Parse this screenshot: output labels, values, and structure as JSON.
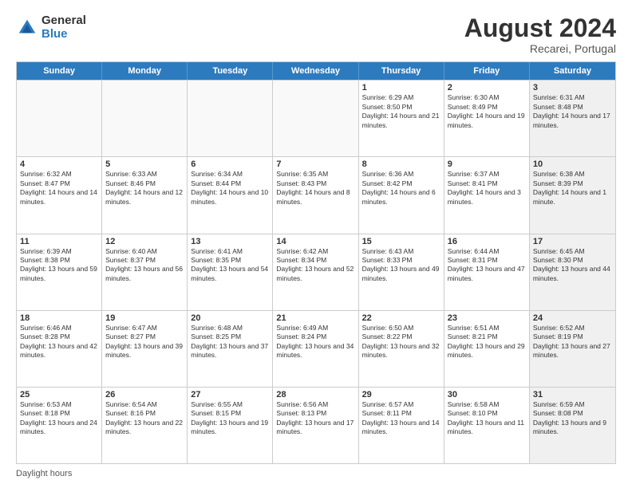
{
  "header": {
    "logo_general": "General",
    "logo_blue": "Blue",
    "month_title": "August 2024",
    "subtitle": "Recarei, Portugal"
  },
  "calendar": {
    "days": [
      "Sunday",
      "Monday",
      "Tuesday",
      "Wednesday",
      "Thursday",
      "Friday",
      "Saturday"
    ],
    "rows": [
      [
        {
          "day": "",
          "empty": true
        },
        {
          "day": "",
          "empty": true
        },
        {
          "day": "",
          "empty": true
        },
        {
          "day": "",
          "empty": true
        },
        {
          "day": "1",
          "sunrise": "6:29 AM",
          "sunset": "8:50 PM",
          "daylight": "14 hours and 21 minutes."
        },
        {
          "day": "2",
          "sunrise": "6:30 AM",
          "sunset": "8:49 PM",
          "daylight": "14 hours and 19 minutes."
        },
        {
          "day": "3",
          "sunrise": "6:31 AM",
          "sunset": "8:48 PM",
          "daylight": "14 hours and 17 minutes.",
          "shaded": true
        }
      ],
      [
        {
          "day": "4",
          "sunrise": "6:32 AM",
          "sunset": "8:47 PM",
          "daylight": "14 hours and 14 minutes."
        },
        {
          "day": "5",
          "sunrise": "6:33 AM",
          "sunset": "8:46 PM",
          "daylight": "14 hours and 12 minutes."
        },
        {
          "day": "6",
          "sunrise": "6:34 AM",
          "sunset": "8:44 PM",
          "daylight": "14 hours and 10 minutes."
        },
        {
          "day": "7",
          "sunrise": "6:35 AM",
          "sunset": "8:43 PM",
          "daylight": "14 hours and 8 minutes."
        },
        {
          "day": "8",
          "sunrise": "6:36 AM",
          "sunset": "8:42 PM",
          "daylight": "14 hours and 6 minutes."
        },
        {
          "day": "9",
          "sunrise": "6:37 AM",
          "sunset": "8:41 PM",
          "daylight": "14 hours and 3 minutes."
        },
        {
          "day": "10",
          "sunrise": "6:38 AM",
          "sunset": "8:39 PM",
          "daylight": "14 hours and 1 minute.",
          "shaded": true
        }
      ],
      [
        {
          "day": "11",
          "sunrise": "6:39 AM",
          "sunset": "8:38 PM",
          "daylight": "13 hours and 59 minutes."
        },
        {
          "day": "12",
          "sunrise": "6:40 AM",
          "sunset": "8:37 PM",
          "daylight": "13 hours and 56 minutes."
        },
        {
          "day": "13",
          "sunrise": "6:41 AM",
          "sunset": "8:35 PM",
          "daylight": "13 hours and 54 minutes."
        },
        {
          "day": "14",
          "sunrise": "6:42 AM",
          "sunset": "8:34 PM",
          "daylight": "13 hours and 52 minutes."
        },
        {
          "day": "15",
          "sunrise": "6:43 AM",
          "sunset": "8:33 PM",
          "daylight": "13 hours and 49 minutes."
        },
        {
          "day": "16",
          "sunrise": "6:44 AM",
          "sunset": "8:31 PM",
          "daylight": "13 hours and 47 minutes."
        },
        {
          "day": "17",
          "sunrise": "6:45 AM",
          "sunset": "8:30 PM",
          "daylight": "13 hours and 44 minutes.",
          "shaded": true
        }
      ],
      [
        {
          "day": "18",
          "sunrise": "6:46 AM",
          "sunset": "8:28 PM",
          "daylight": "13 hours and 42 minutes."
        },
        {
          "day": "19",
          "sunrise": "6:47 AM",
          "sunset": "8:27 PM",
          "daylight": "13 hours and 39 minutes."
        },
        {
          "day": "20",
          "sunrise": "6:48 AM",
          "sunset": "8:25 PM",
          "daylight": "13 hours and 37 minutes."
        },
        {
          "day": "21",
          "sunrise": "6:49 AM",
          "sunset": "8:24 PM",
          "daylight": "13 hours and 34 minutes."
        },
        {
          "day": "22",
          "sunrise": "6:50 AM",
          "sunset": "8:22 PM",
          "daylight": "13 hours and 32 minutes."
        },
        {
          "day": "23",
          "sunrise": "6:51 AM",
          "sunset": "8:21 PM",
          "daylight": "13 hours and 29 minutes."
        },
        {
          "day": "24",
          "sunrise": "6:52 AM",
          "sunset": "8:19 PM",
          "daylight": "13 hours and 27 minutes.",
          "shaded": true
        }
      ],
      [
        {
          "day": "25",
          "sunrise": "6:53 AM",
          "sunset": "8:18 PM",
          "daylight": "13 hours and 24 minutes."
        },
        {
          "day": "26",
          "sunrise": "6:54 AM",
          "sunset": "8:16 PM",
          "daylight": "13 hours and 22 minutes."
        },
        {
          "day": "27",
          "sunrise": "6:55 AM",
          "sunset": "8:15 PM",
          "daylight": "13 hours and 19 minutes."
        },
        {
          "day": "28",
          "sunrise": "6:56 AM",
          "sunset": "8:13 PM",
          "daylight": "13 hours and 17 minutes."
        },
        {
          "day": "29",
          "sunrise": "6:57 AM",
          "sunset": "8:11 PM",
          "daylight": "13 hours and 14 minutes."
        },
        {
          "day": "30",
          "sunrise": "6:58 AM",
          "sunset": "8:10 PM",
          "daylight": "13 hours and 11 minutes."
        },
        {
          "day": "31",
          "sunrise": "6:59 AM",
          "sunset": "8:08 PM",
          "daylight": "13 hours and 9 minutes.",
          "shaded": true
        }
      ]
    ]
  },
  "footer": {
    "daylight_label": "Daylight hours"
  }
}
